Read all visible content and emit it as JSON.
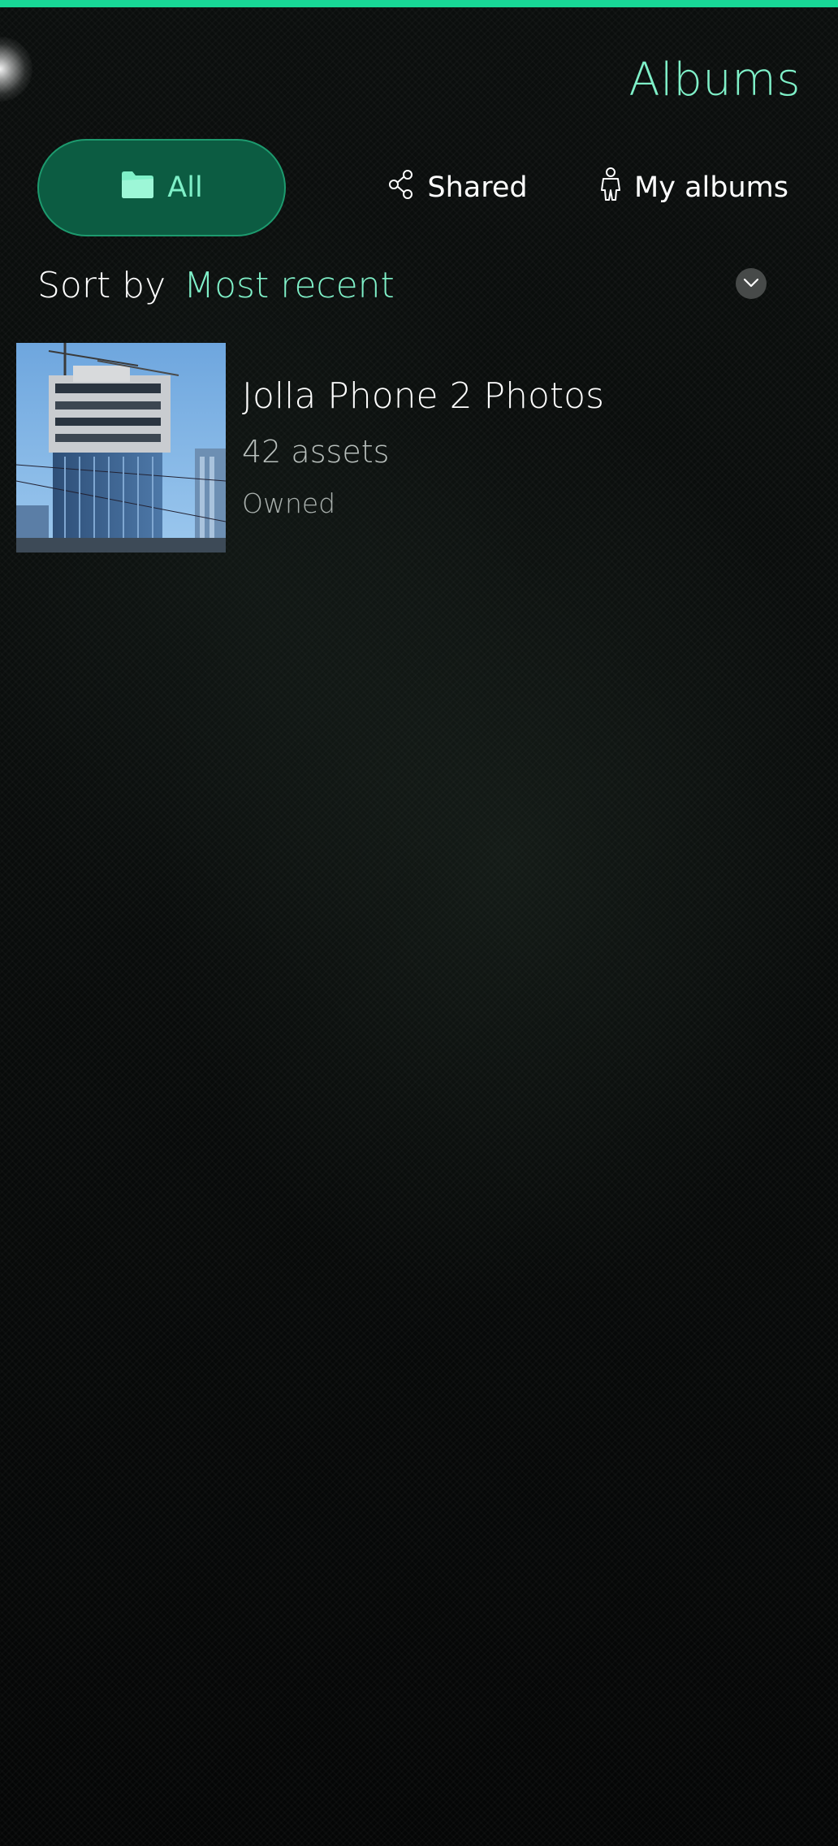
{
  "header": {
    "title": "Albums"
  },
  "tabs": [
    {
      "label": "All",
      "icon": "folder-icon",
      "selected": true
    },
    {
      "label": "Shared",
      "icon": "share-icon",
      "selected": false
    },
    {
      "label": "My albums",
      "icon": "person-icon",
      "selected": false
    }
  ],
  "sort": {
    "label": "Sort by",
    "value": "Most recent"
  },
  "albums": [
    {
      "title": "Jolla Phone 2 Photos",
      "count": "42 assets",
      "ownership": "Owned",
      "thumbnail": "building-construction-photo"
    }
  ],
  "colors": {
    "accent": "#7ff0c8",
    "accent_bar": "#18d796",
    "selected_tab_bg": "#0c5c42"
  }
}
